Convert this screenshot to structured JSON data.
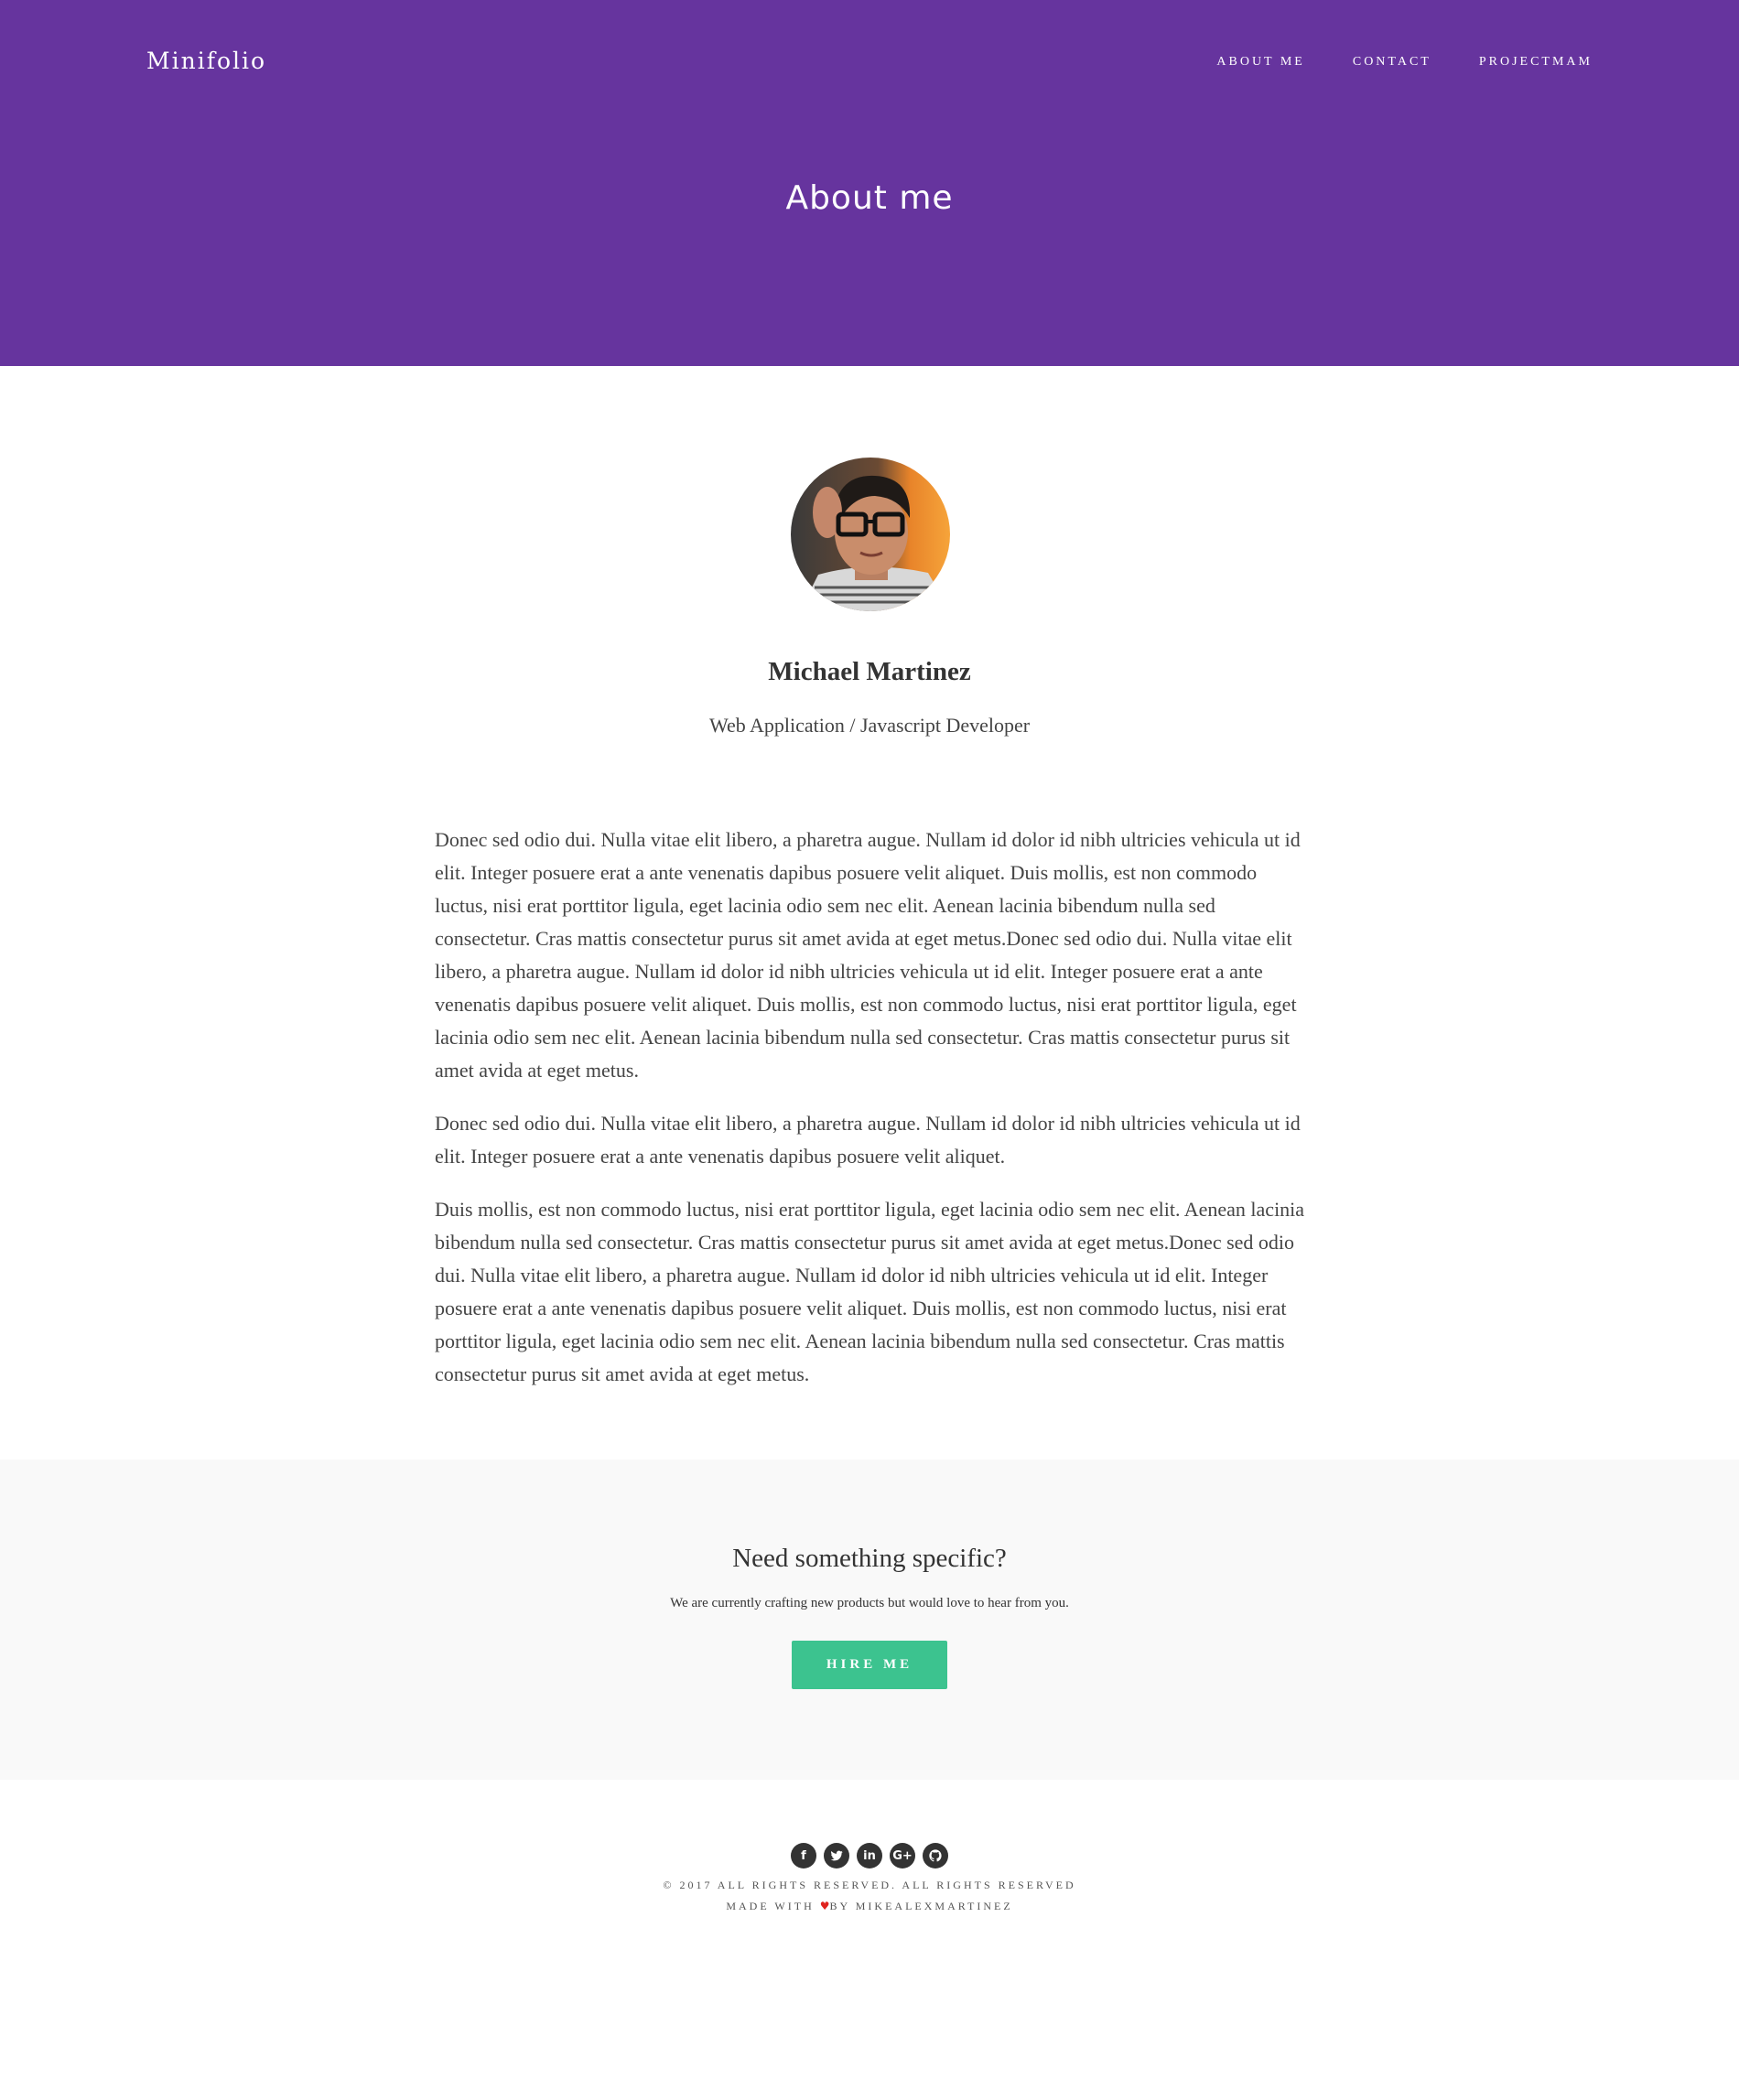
{
  "colors": {
    "header_bg": "#66349e",
    "cta_bg": "#f9f9f9",
    "button_bg": "#3cc38f",
    "heart": "#e0241f",
    "social_icon_bg": "#333333"
  },
  "header": {
    "brand": "Minifolio",
    "nav": [
      {
        "label": "About me"
      },
      {
        "label": "Contact"
      },
      {
        "label": "ProjectMAM"
      }
    ],
    "title": "About me"
  },
  "profile": {
    "name": "Michael Martinez",
    "role": "Web Application / Javascript Developer",
    "paragraphs": [
      "Donec sed odio dui. Nulla vitae elit libero, a pharetra augue. Nullam id dolor id nibh ultricies vehicula ut id elit. Integer posuere erat a ante venenatis dapibus posuere velit aliquet. Duis mollis, est non commodo luctus, nisi erat porttitor ligula, eget lacinia odio sem nec elit. Aenean lacinia bibendum nulla sed consectetur. Cras mattis consectetur purus sit amet avida at eget metus.Donec sed odio dui. Nulla vitae elit libero, a pharetra augue. Nullam id dolor id nibh ultricies vehicula ut id elit. Integer posuere erat a ante venenatis dapibus posuere velit aliquet. Duis mollis, est non commodo luctus, nisi erat porttitor ligula, eget lacinia odio sem nec elit. Aenean lacinia bibendum nulla sed consectetur. Cras mattis consectetur purus sit amet avida at eget metus.",
      "Donec sed odio dui. Nulla vitae elit libero, a pharetra augue. Nullam id dolor id nibh ultricies vehicula ut id elit. Integer posuere erat a ante venenatis dapibus posuere velit aliquet.",
      "Duis mollis, est non commodo luctus, nisi erat porttitor ligula, eget lacinia odio sem nec elit. Aenean lacinia bibendum nulla sed consectetur. Cras mattis consectetur purus sit amet avida at eget metus.Donec sed odio dui. Nulla vitae elit libero, a pharetra augue. Nullam id dolor id nibh ultricies vehicula ut id elit. Integer posuere erat a ante venenatis dapibus posuere velit aliquet. Duis mollis, est non commodo luctus, nisi erat porttitor ligula, eget lacinia odio sem nec elit. Aenean lacinia bibendum nulla sed consectetur. Cras mattis consectetur purus sit amet avida at eget metus."
    ]
  },
  "cta": {
    "title": "Need something specific?",
    "subtitle": "We are currently crafting new products but would love to hear from you.",
    "button": "Hire me"
  },
  "footer": {
    "socials": [
      {
        "icon": "facebook-icon",
        "glyph": "f"
      },
      {
        "icon": "twitter-icon",
        "glyph": ""
      },
      {
        "icon": "linkedin-icon",
        "glyph": "in"
      },
      {
        "icon": "google-plus-icon",
        "glyph": "G+"
      },
      {
        "icon": "github-icon",
        "glyph": ""
      }
    ],
    "copyright": "© 2017 All rights reserved. All rights reserved",
    "made_with_prefix": "Made with",
    "heart": "♥",
    "made_with_suffix": "by mikealexmartinez"
  }
}
